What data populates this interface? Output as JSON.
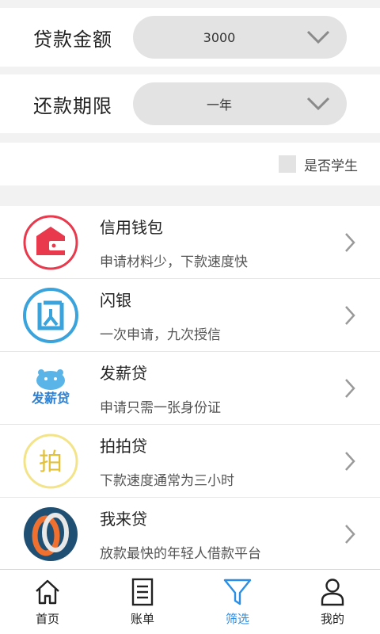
{
  "filters": {
    "amount": {
      "label": "贷款金额",
      "value": "3000"
    },
    "term": {
      "label": "还款期限",
      "value": "一年"
    },
    "student": {
      "label": "是否学生",
      "checked": false
    }
  },
  "loans": [
    {
      "name": "信用钱包",
      "desc": "申请材料少，下款速度快",
      "icon": "wallet-logo"
    },
    {
      "name": "闪银",
      "desc": "一次申请，九次授信",
      "icon": "shanyin-logo"
    },
    {
      "name": "发薪贷",
      "desc": "申请只需一张身份证",
      "icon": "faxindai-logo",
      "logo_text": "发薪贷"
    },
    {
      "name": "拍拍贷",
      "desc": "下款速度通常为三小时",
      "icon": "paipaidai-logo",
      "logo_text": "拍"
    },
    {
      "name": "我来贷",
      "desc": "放款最快的年轻人借款平台",
      "icon": "wolaidai-logo"
    }
  ],
  "tabs": [
    {
      "label": "首页",
      "icon": "home-icon",
      "active": false
    },
    {
      "label": "账单",
      "icon": "bill-icon",
      "active": false
    },
    {
      "label": "筛选",
      "icon": "filter-icon",
      "active": true
    },
    {
      "label": "我的",
      "icon": "user-icon",
      "active": false
    }
  ],
  "colors": {
    "accent": "#2a8ee4",
    "pill_bg": "#e3e3e3",
    "page_bg": "#f2f2f2"
  }
}
